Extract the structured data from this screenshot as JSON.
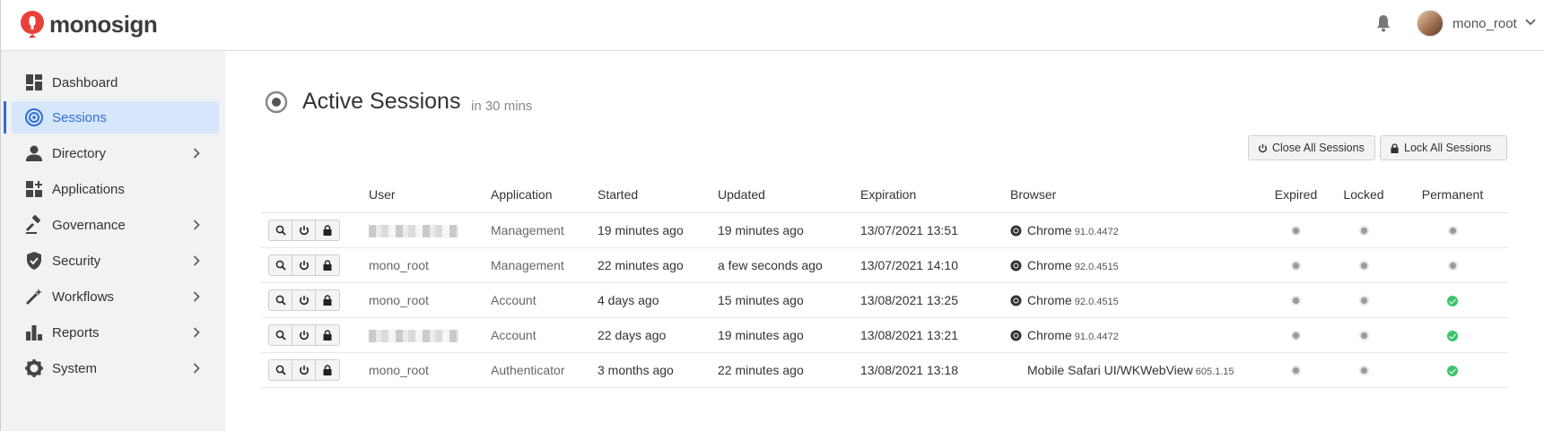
{
  "app": {
    "logo_text": "monosign",
    "brand_color": "#e8413a",
    "accent_color": "#2e6fd6"
  },
  "header": {
    "username": "mono_root",
    "icons": [
      "bell-icon",
      "avatar",
      "chevron-down-icon"
    ]
  },
  "sidebar": {
    "items": [
      {
        "label": "Dashboard",
        "icon": "dashboard-icon",
        "has_children": false,
        "active": false
      },
      {
        "label": "Sessions",
        "icon": "sessions-icon",
        "has_children": false,
        "active": true
      },
      {
        "label": "Directory",
        "icon": "user-icon",
        "has_children": true,
        "active": false
      },
      {
        "label": "Applications",
        "icon": "applications-icon",
        "has_children": false,
        "active": false
      },
      {
        "label": "Governance",
        "icon": "gavel-icon",
        "has_children": true,
        "active": false
      },
      {
        "label": "Security",
        "icon": "shield-icon",
        "has_children": true,
        "active": false
      },
      {
        "label": "Workflows",
        "icon": "wand-icon",
        "has_children": true,
        "active": false
      },
      {
        "label": "Reports",
        "icon": "bar-chart-icon",
        "has_children": true,
        "active": false
      },
      {
        "label": "System",
        "icon": "gear-icon",
        "has_children": true,
        "active": false
      }
    ]
  },
  "page": {
    "title": "Active Sessions",
    "subtitle": "in 30 mins",
    "close_all_label": "Close All Sessions",
    "lock_all_label": "Lock All Sessions"
  },
  "table": {
    "columns": [
      "",
      "User",
      "Application",
      "Started",
      "Updated",
      "Expiration",
      "Browser",
      "Expired",
      "Locked",
      "Permanent"
    ],
    "rows": [
      {
        "user": "",
        "user_redacted": true,
        "application": "Management",
        "started": "19 minutes ago",
        "updated": "19 minutes ago",
        "expiration": "13/07/2021 13:51",
        "browser": "Chrome",
        "browser_version": "91.0.4472",
        "browser_icon": "chrome-icon",
        "expired": false,
        "locked": false,
        "permanent": false
      },
      {
        "user": "mono_root",
        "user_redacted": false,
        "application": "Management",
        "started": "22 minutes ago",
        "updated": "a few seconds ago",
        "expiration": "13/07/2021 14:10",
        "browser": "Chrome",
        "browser_version": "92.0.4515",
        "browser_icon": "chrome-icon",
        "expired": false,
        "locked": false,
        "permanent": false
      },
      {
        "user": "mono_root",
        "user_redacted": false,
        "application": "Account",
        "started": "4 days ago",
        "updated": "15 minutes ago",
        "expiration": "13/08/2021 13:25",
        "browser": "Chrome",
        "browser_version": "92.0.4515",
        "browser_icon": "chrome-icon",
        "expired": false,
        "locked": false,
        "permanent": true
      },
      {
        "user": "",
        "user_redacted": true,
        "application": "Account",
        "started": "22 days ago",
        "updated": "19 minutes ago",
        "expiration": "13/08/2021 13:21",
        "browser": "Chrome",
        "browser_version": "91.0.4472",
        "browser_icon": "chrome-icon",
        "expired": false,
        "locked": false,
        "permanent": true
      },
      {
        "user": "mono_root",
        "user_redacted": false,
        "application": "Authenticator",
        "started": "3 months ago",
        "updated": "22 minutes ago",
        "expiration": "13/08/2021 13:18",
        "browser": "Mobile Safari UI/WKWebView",
        "browser_version": "605.1.15",
        "browser_icon": "",
        "expired": false,
        "locked": false,
        "permanent": true
      }
    ]
  }
}
